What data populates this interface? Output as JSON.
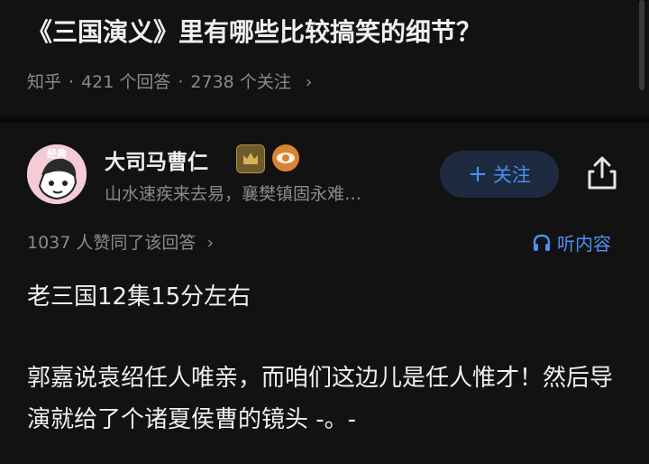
{
  "question": {
    "title": "《三国演义》里有哪些比较搞笑的细节？",
    "source": "知乎",
    "answers": "421 个回答",
    "follows": "2738 个关注",
    "chevron": "›"
  },
  "author": {
    "name": "大司马曹仁",
    "bio": "山水速疾来去易，襄樊镇固永难…",
    "avatar_text": "经典"
  },
  "actions": {
    "follow_label": "关注",
    "follow_plus": "+",
    "listen_label": "听内容"
  },
  "answer": {
    "votes": "1037 人赞同了该回答",
    "votes_chevron": "›",
    "paragraphs": [
      "老三国12集15分左右",
      "郭嘉说袁绍任人唯亲，而咱们这边儿是任人惟才！然后导演就给了个诸夏侯曹的镜头 -。-"
    ]
  },
  "colors": {
    "background": "#121212",
    "accent": "#4a90f5",
    "muted": "#8a8a8a"
  }
}
